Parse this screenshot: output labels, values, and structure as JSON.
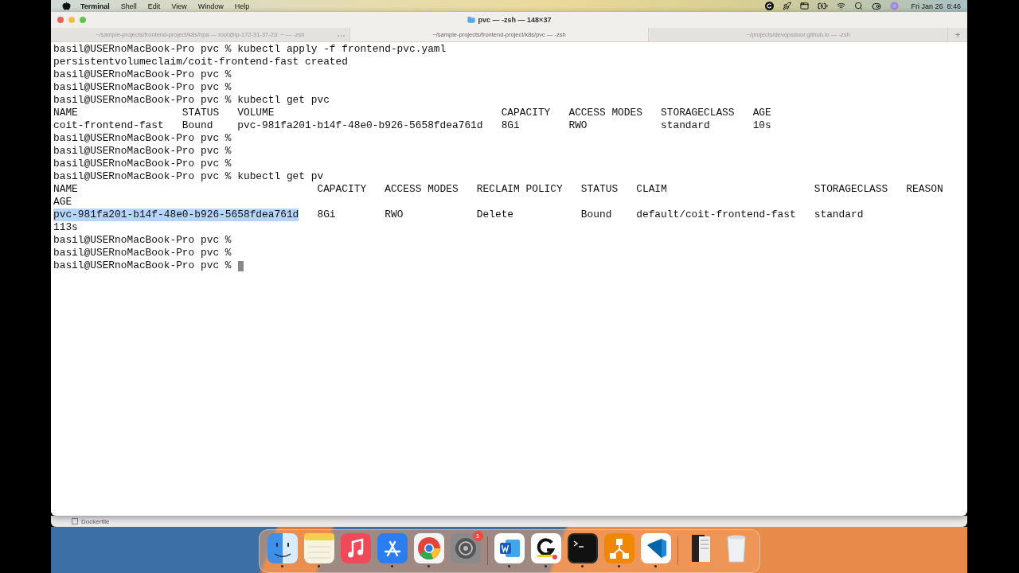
{
  "menu_bar": {
    "app": "Terminal",
    "menus": [
      "Shell",
      "Edit",
      "View",
      "Window",
      "Help"
    ],
    "clock": "Fri Jan 26  8:46"
  },
  "window": {
    "title": "pvc — -zsh — 148×37"
  },
  "tabs": [
    {
      "label": "~/sample-projects/frontend-project/k8s/hpa — root@ip-172-31-37-23: ~ — -zsh",
      "selected": false
    },
    {
      "label": "~/sample-projects/frontend-project/k8s/pvc — -zsh",
      "selected": true
    },
    {
      "label": "~/projects/devopsdoor.github.io — -zsh",
      "selected": false
    }
  ],
  "new_tab": "+",
  "terminal": {
    "cursor": true,
    "lines": [
      {
        "text": "basil@USERnoMacBook-Pro pvc % kubectl apply -f frontend-pvc.yaml"
      },
      {
        "text": "persistentvolumeclaim/coit-frontend-fast created"
      },
      {
        "text": "basil@USERnoMacBook-Pro pvc %"
      },
      {
        "text": "basil@USERnoMacBook-Pro pvc %"
      },
      {
        "text": "basil@USERnoMacBook-Pro pvc % kubectl get pvc"
      },
      {
        "text": "NAME                 STATUS   VOLUME                                     CAPACITY   ACCESS MODES   STORAGECLASS   AGE"
      },
      {
        "text": "coit-frontend-fast   Bound    pvc-981fa201-b14f-48e0-b926-5658fdea761d   8Gi        RWO            standard       10s"
      },
      {
        "text": "basil@USERnoMacBook-Pro pvc %"
      },
      {
        "text": "basil@USERnoMacBook-Pro pvc %"
      },
      {
        "text": "basil@USERnoMacBook-Pro pvc %"
      },
      {
        "text": "basil@USERnoMacBook-Pro pvc % kubectl get pv"
      },
      {
        "text": "NAME                                       CAPACITY   ACCESS MODES   RECLAIM POLICY   STATUS   CLAIM                        STORAGECLASS   REASON"
      },
      {
        "text": "AGE"
      },
      {
        "selection": "pvc-981fa201-b14f-48e0-b926-5658fdea761d",
        "text": "   8Gi        RWO            Delete           Bound    default/coit-frontend-fast   standard"
      },
      {
        "text": "113s"
      },
      {
        "text": "basil@USERnoMacBook-Pro pvc %"
      },
      {
        "text": "basil@USERnoMacBook-Pro pvc %"
      },
      {
        "text": "basil@USERnoMacBook-Pro pvc %"
      }
    ]
  },
  "background_window": {
    "file": "Dockerfile"
  },
  "dock": {
    "apps": [
      {
        "kind": "finder",
        "running": true
      },
      {
        "kind": "notes",
        "running": true
      },
      {
        "kind": "music",
        "running": false
      },
      {
        "kind": "appstore",
        "running": true
      },
      {
        "kind": "chrome",
        "running": true
      },
      {
        "kind": "settings",
        "running": false,
        "badge": "1"
      },
      {
        "kind": "separator"
      },
      {
        "kind": "word",
        "running": true
      },
      {
        "kind": "grammarly",
        "running": true
      },
      {
        "kind": "terminal",
        "running": true
      },
      {
        "kind": "diagram",
        "running": true
      },
      {
        "kind": "vscode",
        "running": true
      },
      {
        "kind": "separator"
      },
      {
        "kind": "stack"
      },
      {
        "kind": "trash"
      }
    ]
  }
}
